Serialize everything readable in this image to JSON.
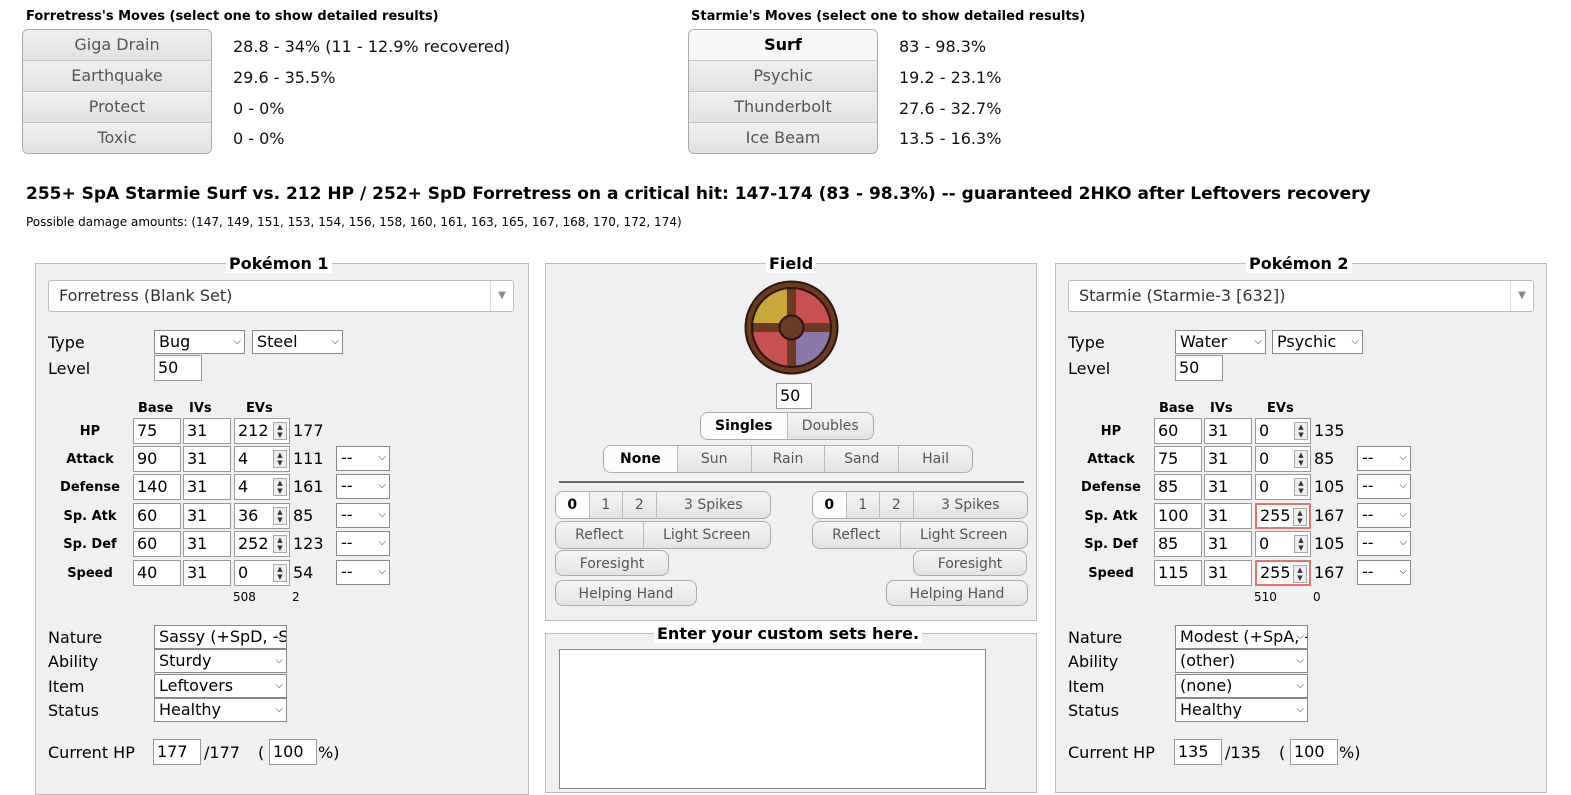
{
  "p1_moves": {
    "header": "Forretress's Moves (select one to show detailed results)",
    "items": [
      {
        "name": "Giga Drain",
        "result": "28.8 - 34% (11 - 12.9% recovered)"
      },
      {
        "name": "Earthquake",
        "result": "29.6 - 35.5%"
      },
      {
        "name": "Protect",
        "result": "0 - 0%"
      },
      {
        "name": "Toxic",
        "result": "0 - 0%"
      }
    ]
  },
  "p2_moves": {
    "header": "Starmie's Moves (select one to show detailed results)",
    "items": [
      {
        "name": "Surf",
        "result": "83 - 98.3%"
      },
      {
        "name": "Psychic",
        "result": "19.2 - 23.1%"
      },
      {
        "name": "Thunderbolt",
        "result": "27.6 - 32.7%"
      },
      {
        "name": "Ice Beam",
        "result": "13.5 - 16.3%"
      }
    ]
  },
  "summary": "255+ SpA Starmie Surf vs. 212 HP / 252+ SpD Forretress on a critical hit: 147-174 (83 - 98.3%) -- guaranteed 2HKO after Leftovers recovery",
  "possible": "Possible damage amounts: (147, 149, 151, 153, 154, 156, 158, 160, 161, 163, 165, 167, 168, 170, 172, 174)",
  "labels": {
    "type": "Type",
    "level": "Level",
    "base": "Base",
    "ivs": "IVs",
    "evs": "EVs",
    "nature": "Nature",
    "ability": "Ability",
    "item": "Item",
    "status": "Status",
    "current_hp": "Current HP",
    "paren_open": "(",
    "pct_close": "%)",
    "stats": [
      "HP",
      "Attack",
      "Defense",
      "Sp. Atk",
      "Sp. Def",
      "Speed"
    ],
    "boost": "--"
  },
  "p1": {
    "title": "Pokémon 1",
    "set": "Forretress (Blank Set)",
    "type1": "Bug",
    "type2": "Steel",
    "level": "50",
    "stats": [
      {
        "base": "75",
        "iv": "31",
        "ev": "212",
        "total": "177"
      },
      {
        "base": "90",
        "iv": "31",
        "ev": "4",
        "total": "111"
      },
      {
        "base": "140",
        "iv": "31",
        "ev": "4",
        "total": "161"
      },
      {
        "base": "60",
        "iv": "31",
        "ev": "36",
        "total": "85"
      },
      {
        "base": "60",
        "iv": "31",
        "ev": "252",
        "total": "123"
      },
      {
        "base": "40",
        "iv": "31",
        "ev": "0",
        "total": "54"
      }
    ],
    "ev_total": "508",
    "ev_left": "2",
    "nature": "Sassy (+SpD, -Spe)",
    "ability": "Sturdy",
    "item": "Leftovers",
    "status": "Healthy",
    "hp_cur": "177",
    "hp_max": "/177",
    "hp_pct": "100"
  },
  "p2": {
    "title": "Pokémon 2",
    "set": "Starmie (Starmie-3 [632])",
    "type1": "Water",
    "type2": "Psychic",
    "level": "50",
    "stats": [
      {
        "base": "60",
        "iv": "31",
        "ev": "0",
        "total": "135"
      },
      {
        "base": "75",
        "iv": "31",
        "ev": "0",
        "total": "85"
      },
      {
        "base": "85",
        "iv": "31",
        "ev": "0",
        "total": "105"
      },
      {
        "base": "100",
        "iv": "31",
        "ev": "255",
        "total": "167"
      },
      {
        "base": "85",
        "iv": "31",
        "ev": "0",
        "total": "105"
      },
      {
        "base": "115",
        "iv": "31",
        "ev": "255",
        "total": "167"
      }
    ],
    "ev_total": "510",
    "ev_left": "0",
    "nature": "Modest (+SpA, -Atk)",
    "ability": "(other)",
    "item": "(none)",
    "status": "Healthy",
    "hp_cur": "135",
    "hp_max": "/135",
    "hp_pct": "100"
  },
  "field": {
    "title": "Field",
    "level": "50",
    "format": [
      "Singles",
      "Doubles"
    ],
    "weather": [
      "None",
      "Sun",
      "Rain",
      "Sand",
      "Hail"
    ],
    "spikes": [
      "0",
      "1",
      "2",
      "3 Spikes"
    ],
    "reflect": "Reflect",
    "light_screen": "Light Screen",
    "foresight": "Foresight",
    "helping_hand": "Helping Hand"
  },
  "custom": {
    "title": "Enter your custom sets here."
  }
}
